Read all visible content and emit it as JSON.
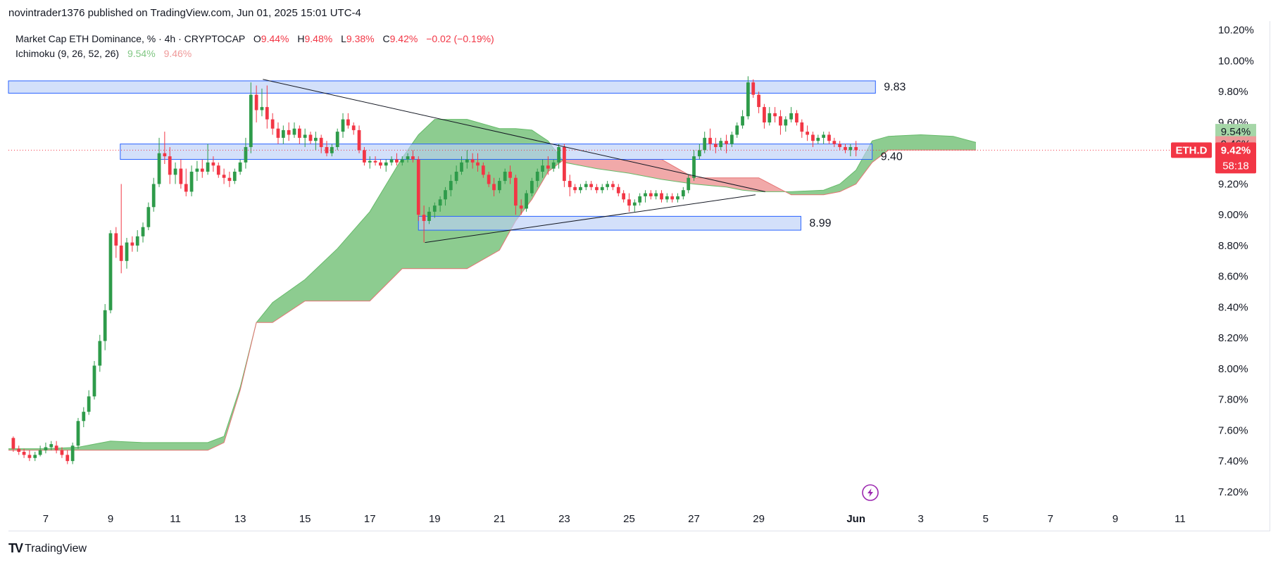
{
  "header": {
    "published_line": "novintrader1376 published on TradingView.com, Jun 01, 2025 15:01 UTC-4"
  },
  "legend": {
    "symbol": "Market Cap ETH Dominance, % · 4h · CRYPTOCAP",
    "open_label": "O",
    "open_value": "9.44%",
    "high_label": "H",
    "high_value": "9.48%",
    "low_label": "L",
    "low_value": "9.38%",
    "close_label": "C",
    "close_value": "9.42%",
    "change": "−0.02 (−0.19%)",
    "indicator": "Ichimoku (9, 26, 52, 26)",
    "indicator_val_a": "9.54%",
    "indicator_val_b": "9.46%"
  },
  "footer": {
    "brand": "TradingView",
    "logo": "TV"
  },
  "colors": {
    "up": "#089981",
    "down": "#f23645",
    "candle_up": "#2e9b4a",
    "candle_down": "#f23645",
    "cloud_green": "#81c784",
    "cloud_red": "#ef9a9a",
    "zone_fill": "#bbd0f7",
    "zone_stroke": "#2962ff",
    "axis_text": "#131722",
    "price_tag_bg": "#f23645",
    "lightning": "#9c27b0"
  },
  "chart_data": {
    "type": "candlestick",
    "title": "Market Cap ETH Dominance, % · 4h · CRYPTOCAP",
    "ylim": [
      7.14,
      10.24
    ],
    "y_ticks": [
      "7.20%",
      "7.40%",
      "7.60%",
      "7.80%",
      "8.00%",
      "8.20%",
      "8.40%",
      "8.60%",
      "8.80%",
      "9.00%",
      "9.20%",
      "9.40%",
      "9.60%",
      "9.80%",
      "10.00%",
      "10.20%"
    ],
    "x_ticks": [
      "7",
      "9",
      "11",
      "13",
      "15",
      "17",
      "19",
      "21",
      "23",
      "25",
      "27",
      "29",
      "Jun",
      "3",
      "5",
      "7",
      "9",
      "11"
    ],
    "x_tick_days": [
      7,
      9,
      11,
      13,
      15,
      17,
      19,
      21,
      23,
      25,
      27,
      29,
      32,
      34,
      36,
      38,
      40,
      42
    ],
    "x_day_range": [
      5.85,
      43.0
    ],
    "last_price": {
      "symbol": "ETH.D",
      "value": "9.42%",
      "countdown": "58:18",
      "price": 9.42
    },
    "cloud_labels": [
      {
        "text": "9.54%",
        "price": 9.54,
        "color": "green"
      },
      {
        "text": "9.46%",
        "price": 9.46,
        "color": "red"
      }
    ],
    "zones": [
      {
        "label": "9.83",
        "low": 9.79,
        "high": 9.87,
        "day_start": 5.85,
        "day_end": 32.6
      },
      {
        "label": "9.40",
        "low": 9.36,
        "high": 9.46,
        "day_start": 9.3,
        "day_end": 32.5
      },
      {
        "label": "8.99",
        "low": 8.9,
        "high": 8.99,
        "day_start": 18.5,
        "day_end": 30.3
      }
    ],
    "trendlines": [
      {
        "from": [
          13.7,
          9.88
        ],
        "to": [
          29.2,
          9.15
        ]
      },
      {
        "from": [
          18.7,
          8.82
        ],
        "to": [
          28.9,
          9.13
        ]
      }
    ],
    "cloud": {
      "days": [
        5.85,
        7,
        8,
        9,
        10,
        11,
        12,
        12.5,
        13,
        13.5,
        14,
        15,
        16,
        17,
        18,
        18.5,
        19,
        20,
        21,
        21.5,
        22,
        22.5,
        23,
        24,
        25,
        26,
        27,
        28,
        28.5,
        29,
        30,
        31,
        31.5,
        32,
        32.5,
        33,
        34,
        35,
        35.7
      ],
      "span_a": [
        7.48,
        7.48,
        7.49,
        7.53,
        7.52,
        7.52,
        7.52,
        7.56,
        7.88,
        8.3,
        8.43,
        8.58,
        8.78,
        9.02,
        9.37,
        9.52,
        9.62,
        9.62,
        9.56,
        9.56,
        9.55,
        9.48,
        9.34,
        9.3,
        9.27,
        9.23,
        9.2,
        9.18,
        9.16,
        9.15,
        9.15,
        9.16,
        9.2,
        9.29,
        9.48,
        9.51,
        9.52,
        9.51,
        9.47
      ],
      "span_b": [
        7.47,
        7.47,
        7.47,
        7.47,
        7.47,
        7.47,
        7.47,
        7.52,
        7.86,
        8.3,
        8.3,
        8.44,
        8.44,
        8.44,
        8.65,
        8.65,
        8.65,
        8.65,
        8.77,
        8.96,
        9.1,
        9.28,
        9.36,
        9.36,
        9.36,
        9.36,
        9.24,
        9.24,
        9.24,
        9.24,
        9.13,
        9.13,
        9.15,
        9.2,
        9.34,
        9.42,
        9.42,
        9.42,
        9.42
      ]
    },
    "candles": [
      [
        6.0,
        7.55,
        7.56,
        7.46,
        7.48
      ],
      [
        6.17,
        7.48,
        7.5,
        7.44,
        7.46
      ],
      [
        6.33,
        7.46,
        7.48,
        7.42,
        7.44
      ],
      [
        6.5,
        7.44,
        7.47,
        7.4,
        7.42
      ],
      [
        6.67,
        7.42,
        7.46,
        7.4,
        7.44
      ],
      [
        6.83,
        7.44,
        7.5,
        7.43,
        7.47
      ],
      [
        7.0,
        7.47,
        7.52,
        7.45,
        7.49
      ],
      [
        7.17,
        7.49,
        7.53,
        7.47,
        7.51
      ],
      [
        7.33,
        7.5,
        7.53,
        7.45,
        7.47
      ],
      [
        7.5,
        7.47,
        7.49,
        7.42,
        7.44
      ],
      [
        7.67,
        7.44,
        7.47,
        7.38,
        7.4
      ],
      [
        7.83,
        7.4,
        7.52,
        7.38,
        7.5
      ],
      [
        8.0,
        7.5,
        7.68,
        7.48,
        7.66
      ],
      [
        8.17,
        7.66,
        7.75,
        7.62,
        7.72
      ],
      [
        8.33,
        7.72,
        7.86,
        7.7,
        7.82
      ],
      [
        8.5,
        7.82,
        8.05,
        7.8,
        8.02
      ],
      [
        8.67,
        8.02,
        8.22,
        7.98,
        8.18
      ],
      [
        8.83,
        8.18,
        8.42,
        8.12,
        8.38
      ],
      [
        9.0,
        8.38,
        8.9,
        8.36,
        8.88
      ],
      [
        9.17,
        8.88,
        8.92,
        8.72,
        8.8
      ],
      [
        9.33,
        8.8,
        9.2,
        8.62,
        8.7
      ],
      [
        9.5,
        8.7,
        8.85,
        8.65,
        8.82
      ],
      [
        9.67,
        8.82,
        8.86,
        8.76,
        8.8
      ],
      [
        9.83,
        8.8,
        8.9,
        8.76,
        8.86
      ],
      [
        10.0,
        8.86,
        8.95,
        8.82,
        8.92
      ],
      [
        10.17,
        8.92,
        9.08,
        8.9,
        9.05
      ],
      [
        10.33,
        9.05,
        9.24,
        9.02,
        9.2
      ],
      [
        10.5,
        9.2,
        9.5,
        9.18,
        9.4
      ],
      [
        10.67,
        9.4,
        9.54,
        9.33,
        9.38
      ],
      [
        10.83,
        9.38,
        9.44,
        9.2,
        9.26
      ],
      [
        11.0,
        9.26,
        9.34,
        9.2,
        9.3
      ],
      [
        11.17,
        9.3,
        9.36,
        9.17,
        9.2
      ],
      [
        11.33,
        9.2,
        9.3,
        9.12,
        9.15
      ],
      [
        11.5,
        9.15,
        9.32,
        9.12,
        9.28
      ],
      [
        11.67,
        9.28,
        9.35,
        9.22,
        9.3
      ],
      [
        11.83,
        9.3,
        9.36,
        9.24,
        9.28
      ],
      [
        12.0,
        9.28,
        9.46,
        9.26,
        9.34
      ],
      [
        12.17,
        9.34,
        9.38,
        9.28,
        9.32
      ],
      [
        12.33,
        9.32,
        9.34,
        9.24,
        9.26
      ],
      [
        12.5,
        9.26,
        9.3,
        9.2,
        9.24
      ],
      [
        12.67,
        9.24,
        9.28,
        9.18,
        9.22
      ],
      [
        12.83,
        9.22,
        9.3,
        9.2,
        9.28
      ],
      [
        13.0,
        9.28,
        9.36,
        9.26,
        9.34
      ],
      [
        13.17,
        9.34,
        9.5,
        9.3,
        9.44
      ],
      [
        13.33,
        9.44,
        9.86,
        9.4,
        9.78
      ],
      [
        13.5,
        9.78,
        9.84,
        9.6,
        9.68
      ],
      [
        13.67,
        9.68,
        9.82,
        9.64,
        9.7
      ],
      [
        13.83,
        9.7,
        9.84,
        9.56,
        9.62
      ],
      [
        14.0,
        9.62,
        9.66,
        9.52,
        9.56
      ],
      [
        14.17,
        9.56,
        9.6,
        9.46,
        9.5
      ],
      [
        14.33,
        9.5,
        9.58,
        9.46,
        9.55
      ],
      [
        14.5,
        9.55,
        9.6,
        9.48,
        9.52
      ],
      [
        14.67,
        9.52,
        9.6,
        9.5,
        9.56
      ],
      [
        14.83,
        9.56,
        9.58,
        9.46,
        9.5
      ],
      [
        15.0,
        9.5,
        9.56,
        9.44,
        9.52
      ],
      [
        15.17,
        9.52,
        9.54,
        9.46,
        9.48
      ],
      [
        15.33,
        9.48,
        9.54,
        9.42,
        9.5
      ],
      [
        15.5,
        9.5,
        9.52,
        9.4,
        9.44
      ],
      [
        15.67,
        9.44,
        9.48,
        9.38,
        9.4
      ],
      [
        15.83,
        9.4,
        9.46,
        9.38,
        9.44
      ],
      [
        16.0,
        9.44,
        9.56,
        9.42,
        9.54
      ],
      [
        16.17,
        9.54,
        9.66,
        9.5,
        9.62
      ],
      [
        16.33,
        9.62,
        9.66,
        9.56,
        9.58
      ],
      [
        16.5,
        9.58,
        9.6,
        9.52,
        9.55
      ],
      [
        16.67,
        9.55,
        9.58,
        9.4,
        9.42
      ],
      [
        16.83,
        9.42,
        9.44,
        9.32,
        9.34
      ],
      [
        17.0,
        9.34,
        9.38,
        9.3,
        9.35
      ],
      [
        17.17,
        9.35,
        9.38,
        9.32,
        9.34
      ],
      [
        17.33,
        9.34,
        9.36,
        9.3,
        9.32
      ],
      [
        17.5,
        9.32,
        9.36,
        9.28,
        9.34
      ],
      [
        17.67,
        9.34,
        9.38,
        9.32,
        9.36
      ],
      [
        17.83,
        9.36,
        9.4,
        9.32,
        9.34
      ],
      [
        18.0,
        9.34,
        9.38,
        9.32,
        9.36
      ],
      [
        18.17,
        9.36,
        9.4,
        9.34,
        9.38
      ],
      [
        18.33,
        9.38,
        9.42,
        9.34,
        9.36
      ],
      [
        18.5,
        9.36,
        9.38,
        8.96,
        9.0
      ],
      [
        18.67,
        9.0,
        9.06,
        8.82,
        8.96
      ],
      [
        18.83,
        8.96,
        9.05,
        8.94,
        9.02
      ],
      [
        19.0,
        9.02,
        9.08,
        8.98,
        9.06
      ],
      [
        19.17,
        9.06,
        9.12,
        9.02,
        9.1
      ],
      [
        19.33,
        9.1,
        9.18,
        9.06,
        9.16
      ],
      [
        19.5,
        9.16,
        9.26,
        9.12,
        9.22
      ],
      [
        19.67,
        9.22,
        9.32,
        9.2,
        9.28
      ],
      [
        19.83,
        9.28,
        9.38,
        9.26,
        9.34
      ],
      [
        20.0,
        9.34,
        9.42,
        9.3,
        9.36
      ],
      [
        20.17,
        9.36,
        9.4,
        9.3,
        9.34
      ],
      [
        20.33,
        9.34,
        9.4,
        9.28,
        9.32
      ],
      [
        20.5,
        9.32,
        9.34,
        9.24,
        9.26
      ],
      [
        20.67,
        9.26,
        9.28,
        9.18,
        9.2
      ],
      [
        20.83,
        9.2,
        9.24,
        9.12,
        9.16
      ],
      [
        21.0,
        9.16,
        9.24,
        9.14,
        9.22
      ],
      [
        21.17,
        9.22,
        9.3,
        9.2,
        9.28
      ],
      [
        21.33,
        9.28,
        9.32,
        9.2,
        9.24
      ],
      [
        21.5,
        9.24,
        9.26,
        9.0,
        9.06
      ],
      [
        21.67,
        9.06,
        9.1,
        9.0,
        9.04
      ],
      [
        21.83,
        9.04,
        9.16,
        9.02,
        9.14
      ],
      [
        22.0,
        9.14,
        9.24,
        9.12,
        9.22
      ],
      [
        22.17,
        9.22,
        9.3,
        9.18,
        9.28
      ],
      [
        22.33,
        9.28,
        9.36,
        9.24,
        9.32
      ],
      [
        22.5,
        9.32,
        9.38,
        9.26,
        9.3
      ],
      [
        22.67,
        9.3,
        9.36,
        9.28,
        9.34
      ],
      [
        22.83,
        9.34,
        9.46,
        9.3,
        9.44
      ],
      [
        23.0,
        9.44,
        9.46,
        9.18,
        9.22
      ],
      [
        23.17,
        9.22,
        9.26,
        9.12,
        9.18
      ],
      [
        23.33,
        9.18,
        9.2,
        9.14,
        9.16
      ],
      [
        23.5,
        9.16,
        9.2,
        9.14,
        9.18
      ],
      [
        23.67,
        9.18,
        9.22,
        9.16,
        9.2
      ],
      [
        23.83,
        9.2,
        9.22,
        9.16,
        9.18
      ],
      [
        24.0,
        9.18,
        9.2,
        9.14,
        9.16
      ],
      [
        24.17,
        9.16,
        9.2,
        9.14,
        9.18
      ],
      [
        24.33,
        9.18,
        9.22,
        9.16,
        9.2
      ],
      [
        24.5,
        9.2,
        9.22,
        9.16,
        9.18
      ],
      [
        24.67,
        9.18,
        9.2,
        9.12,
        9.14
      ],
      [
        24.83,
        9.14,
        9.16,
        9.08,
        9.1
      ],
      [
        25.0,
        9.1,
        9.14,
        9.02,
        9.06
      ],
      [
        25.17,
        9.06,
        9.1,
        9.02,
        9.08
      ],
      [
        25.33,
        9.08,
        9.14,
        9.06,
        9.12
      ],
      [
        25.5,
        9.12,
        9.16,
        9.08,
        9.14
      ],
      [
        25.67,
        9.14,
        9.16,
        9.1,
        9.12
      ],
      [
        25.83,
        9.12,
        9.16,
        9.1,
        9.14
      ],
      [
        26.0,
        9.14,
        9.16,
        9.08,
        9.1
      ],
      [
        26.17,
        9.1,
        9.14,
        9.08,
        9.12
      ],
      [
        26.33,
        9.12,
        9.14,
        9.08,
        9.1
      ],
      [
        26.5,
        9.1,
        9.14,
        9.08,
        9.12
      ],
      [
        26.67,
        9.12,
        9.18,
        9.1,
        9.16
      ],
      [
        26.83,
        9.16,
        9.26,
        9.14,
        9.24
      ],
      [
        27.0,
        9.24,
        9.42,
        9.22,
        9.38
      ],
      [
        27.17,
        9.38,
        9.46,
        9.36,
        9.42
      ],
      [
        27.33,
        9.42,
        9.54,
        9.4,
        9.5
      ],
      [
        27.5,
        9.5,
        9.56,
        9.42,
        9.46
      ],
      [
        27.67,
        9.46,
        9.5,
        9.4,
        9.44
      ],
      [
        27.83,
        9.44,
        9.5,
        9.42,
        9.48
      ],
      [
        28.0,
        9.48,
        9.52,
        9.4,
        9.46
      ],
      [
        28.17,
        9.46,
        9.54,
        9.44,
        9.52
      ],
      [
        28.33,
        9.52,
        9.6,
        9.5,
        9.58
      ],
      [
        28.5,
        9.58,
        9.68,
        9.56,
        9.64
      ],
      [
        28.67,
        9.64,
        9.9,
        9.62,
        9.86
      ],
      [
        28.83,
        9.86,
        9.88,
        9.76,
        9.78
      ],
      [
        29.0,
        9.78,
        9.8,
        9.66,
        9.7
      ],
      [
        29.17,
        9.7,
        9.72,
        9.56,
        9.6
      ],
      [
        29.33,
        9.6,
        9.7,
        9.58,
        9.66
      ],
      [
        29.5,
        9.66,
        9.7,
        9.6,
        9.64
      ],
      [
        29.67,
        9.64,
        9.68,
        9.52,
        9.58
      ],
      [
        29.83,
        9.58,
        9.64,
        9.54,
        9.62
      ],
      [
        30.0,
        9.62,
        9.7,
        9.6,
        9.66
      ],
      [
        30.17,
        9.66,
        9.68,
        9.58,
        9.6
      ],
      [
        30.33,
        9.6,
        9.62,
        9.5,
        9.54
      ],
      [
        30.5,
        9.54,
        9.58,
        9.48,
        9.52
      ],
      [
        30.67,
        9.52,
        9.54,
        9.44,
        9.48
      ],
      [
        30.83,
        9.48,
        9.52,
        9.46,
        9.5
      ],
      [
        31.0,
        9.5,
        9.54,
        9.46,
        9.52
      ],
      [
        31.17,
        9.52,
        9.54,
        9.46,
        9.48
      ],
      [
        31.33,
        9.48,
        9.5,
        9.44,
        9.46
      ],
      [
        31.5,
        9.46,
        9.48,
        9.42,
        9.44
      ],
      [
        31.67,
        9.44,
        9.46,
        9.4,
        9.42
      ],
      [
        31.83,
        9.42,
        9.46,
        9.38,
        9.44
      ],
      [
        32.0,
        9.44,
        9.48,
        9.38,
        9.42
      ]
    ]
  }
}
